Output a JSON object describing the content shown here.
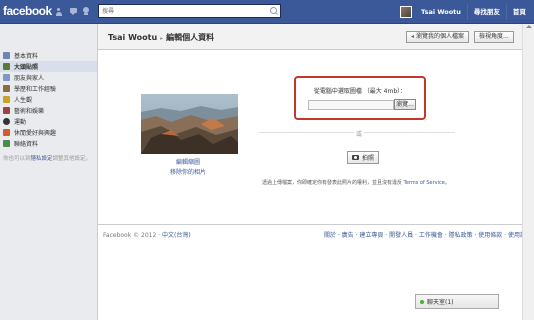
{
  "app": {
    "logo_text": "facebook",
    "brand_color": "#3b5998"
  },
  "topbar": {
    "search_placeholder": "搜尋",
    "user_name": "Tsai Wootu",
    "find_friends": "尋找朋友",
    "home": "首頁"
  },
  "sidebar": {
    "items": [
      {
        "label": "基本資料",
        "icon": "profile-icon",
        "active": false
      },
      {
        "label": "大頭貼照",
        "icon": "photo-icon",
        "active": true
      },
      {
        "label": "朋友與家人",
        "icon": "friends-icon",
        "active": false
      },
      {
        "label": "學歷和工作經驗",
        "icon": "briefcase-icon",
        "active": false
      },
      {
        "label": "人生觀",
        "icon": "philosophy-icon",
        "active": false
      },
      {
        "label": "藝術和娛樂",
        "icon": "arts-icon",
        "active": false
      },
      {
        "label": "運動",
        "icon": "sports-icon",
        "active": false
      },
      {
        "label": "休閒愛好與興趣",
        "icon": "interests-icon",
        "active": false
      },
      {
        "label": "聯絡資料",
        "icon": "contact-icon",
        "active": false
      }
    ],
    "note_prefix": "你也可以到",
    "note_link": "隱私設定",
    "note_suffix": "調整其他設定。"
  },
  "header": {
    "name": "Tsai Wootu",
    "separator": "▸",
    "title": "編輯個人資料",
    "view_profile_button": "瀏覽我的個人檔案",
    "view_as_button": "檢視角度..."
  },
  "photo_panel": {
    "edit_thumbnail": "編輯縮圖",
    "remove_photo": "移除你的相片"
  },
  "upload": {
    "label": "從電腦中選取圖檔 （最大 4mb）：",
    "browse_button": "瀏覽...",
    "or_text": "或",
    "camera_button": "拍照",
    "legal_text": "透過上傳檔案，你即確定你有發表此照片的權利，並且沒有違反",
    "legal_link": "Terms of Service",
    "legal_end": "。"
  },
  "footer": {
    "copyright": "Facebook © 2012 ·",
    "language": "中文(台灣)",
    "links": "關於 · 廣告 · 建立專頁 · 開發人員 · 工作機會 · 隱私政策 · 使用條款 · 使用說明"
  },
  "chat": {
    "label": "聊天室(1)",
    "status_color": "#42b72a"
  }
}
